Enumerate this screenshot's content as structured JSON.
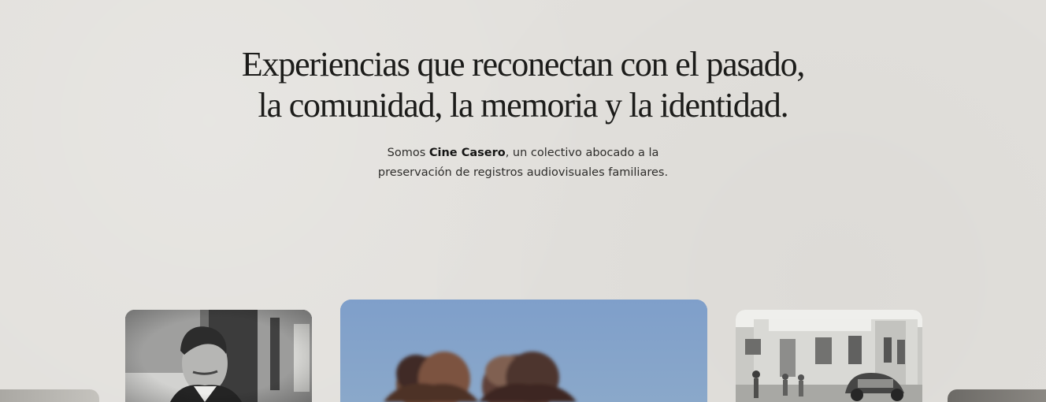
{
  "hero": {
    "headline_line_1": "Experiencias que reconectan con el pasado,",
    "headline_line_2": "la comunidad, la memoria y la identidad.",
    "intro_prefix": "Somos ",
    "intro_brand": "Cine Casero",
    "intro_line_1_suffix": ", un colectivo abocado a la",
    "intro_line_2": "preservación de registros audiovisuales familiares."
  },
  "gallery": {
    "photos": [
      {
        "subject": "partial-archive-photo",
        "tone": "grayscale"
      },
      {
        "subject": "man-in-suit-portrait",
        "tone": "black-and-white"
      },
      {
        "subject": "two-people-sky-background",
        "tone": "color"
      },
      {
        "subject": "street-building-vintage-car",
        "tone": "black-and-white"
      },
      {
        "subject": "partial-archive-photo",
        "tone": "grayscale"
      }
    ]
  },
  "colors": {
    "background": "#e2e0dc",
    "text": "#1c1c1a",
    "muted_text": "#2e2d2b",
    "sky": "#84a0c4"
  }
}
